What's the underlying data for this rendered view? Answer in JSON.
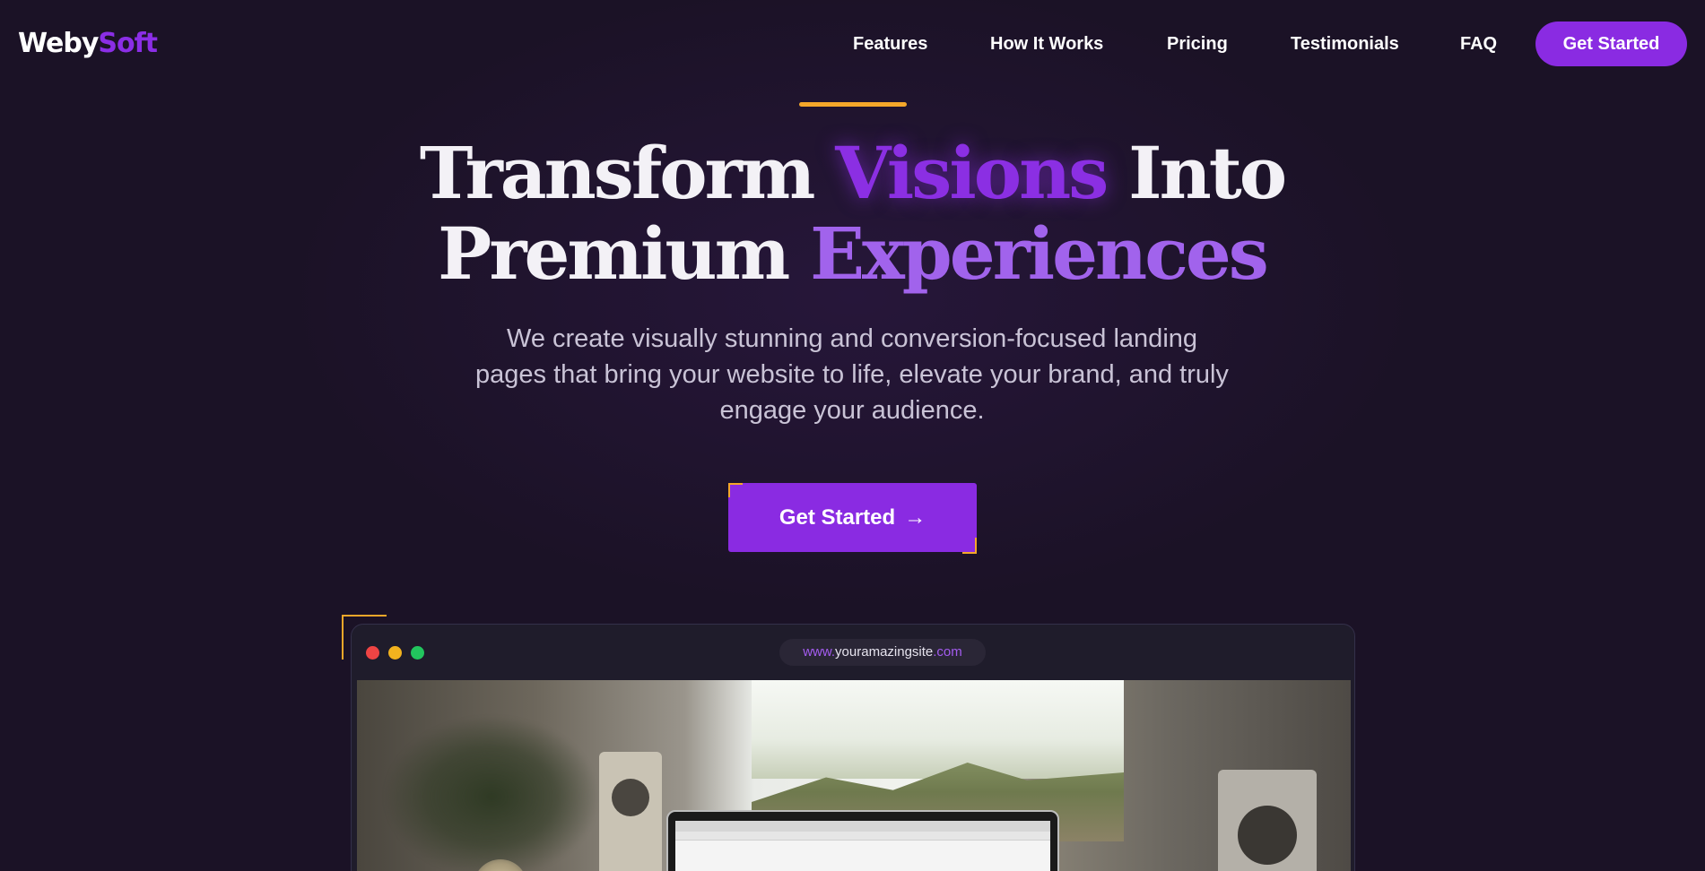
{
  "brand": {
    "logo_part1": "Weby",
    "logo_part2": "Soft"
  },
  "nav": {
    "links": [
      "Features",
      "How It Works",
      "Pricing",
      "Testimonials",
      "FAQ"
    ],
    "cta_label": "Get Started"
  },
  "hero": {
    "headline": {
      "w1": "Transform",
      "w2": "Visions",
      "w3": "Into",
      "w4": "Premium",
      "w5": "Experiences"
    },
    "subtext": "We create visually stunning and conversion-focused landing pages that bring your website to life, elevate your brand, and truly engage your audience.",
    "cta_label": "Get Started",
    "cta_icon": "arrow-right-icon"
  },
  "mockup": {
    "url_prefix": "www.",
    "url_domain": "youramazingsite",
    "url_suffix": ".com"
  },
  "colors": {
    "background": "#1b1226",
    "accent_purple": "#8a2be2",
    "accent_light_purple": "#a163ec",
    "accent_orange": "#f4a72a"
  }
}
